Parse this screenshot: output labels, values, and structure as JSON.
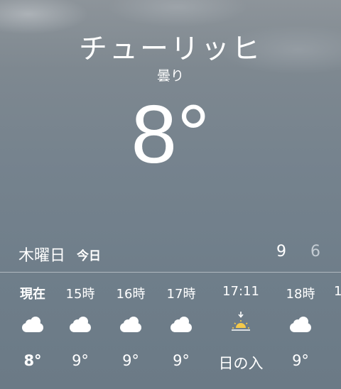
{
  "location": {
    "city": "チューリッヒ",
    "condition": "曇り",
    "temperature": "8°"
  },
  "today": {
    "day": "木曜日",
    "label": "今日",
    "high": "9",
    "low": "6"
  },
  "hourly": [
    {
      "time": "現在",
      "icon": "cloud-icon",
      "value": "8°",
      "bold": true
    },
    {
      "time": "15時",
      "icon": "cloud-icon",
      "value": "9°"
    },
    {
      "time": "16時",
      "icon": "cloud-icon",
      "value": "9°"
    },
    {
      "time": "17時",
      "icon": "cloud-icon",
      "value": "9°"
    },
    {
      "time": "17:11",
      "icon": "sunset-icon",
      "value": "日の入"
    },
    {
      "time": "18時",
      "icon": "cloud-icon",
      "value": "9°"
    }
  ],
  "hourly_partial": {
    "time": "1"
  },
  "colors": {
    "text": "#ffffff",
    "low_temp": "#c4ccd3",
    "sunset": "#f5c94a"
  }
}
